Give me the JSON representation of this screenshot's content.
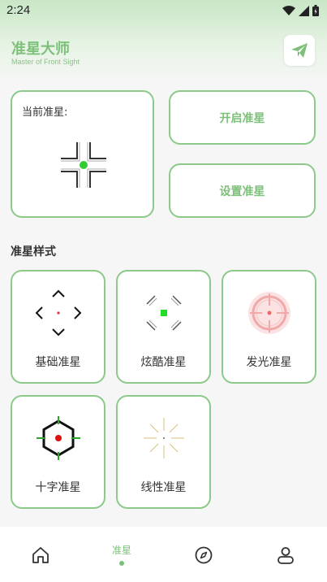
{
  "status_bar": {
    "time": "2:24",
    "icons": [
      "wifi-icon",
      "signal-icon",
      "battery-icon"
    ]
  },
  "header": {
    "title": "准星大师",
    "subtitle": "Master of Front Sight",
    "action_icon": "send-icon"
  },
  "current": {
    "label": "当前准星:",
    "dot_color": "#33cc33"
  },
  "actions": {
    "open_label": "开启准星",
    "set_label": "设置准星"
  },
  "styles": {
    "title": "准星样式",
    "items": [
      {
        "label": "基础准星",
        "icon": "basic-crosshair-icon"
      },
      {
        "label": "炫酷准星",
        "icon": "cool-crosshair-icon"
      },
      {
        "label": "发光准星",
        "icon": "glow-crosshair-icon"
      },
      {
        "label": "十字准星",
        "icon": "cross-crosshair-icon"
      },
      {
        "label": "线性准星",
        "icon": "linear-crosshair-icon"
      }
    ]
  },
  "nav": {
    "items": [
      {
        "name": "home",
        "icon": "home-icon"
      },
      {
        "name": "crosshair",
        "label": "准星",
        "active": true
      },
      {
        "name": "discover",
        "icon": "compass-icon"
      },
      {
        "name": "profile",
        "icon": "user-icon"
      }
    ]
  },
  "colors": {
    "accent": "#7dc07a",
    "border": "#8cc98a"
  }
}
